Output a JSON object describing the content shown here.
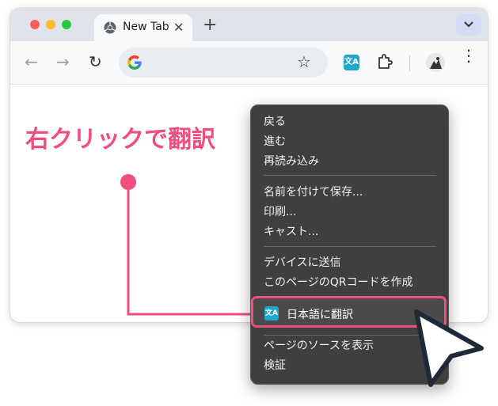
{
  "browser": {
    "tab": {
      "title": "New Tab",
      "close_glyph": "✕",
      "favicon": "chrome-icon"
    },
    "new_tab_glyph": "+",
    "tab_search_glyph": "⌄",
    "nav": {
      "back": "←",
      "forward": "→",
      "reload": "↻"
    },
    "omnibox": {
      "value": "",
      "star_glyph": "☆"
    },
    "extensions": {
      "translate_label": "文A"
    },
    "menu_glyph": "⋮"
  },
  "caption": "右クリックで翻訳",
  "context_menu": {
    "group1": [
      "戻る",
      "進む",
      "再読み込み"
    ],
    "group2": [
      "名前を付けて保存...",
      "印刷...",
      "キャスト..."
    ],
    "group3": [
      "デバイスに送信",
      "このページのQRコードを作成"
    ],
    "highlighted": {
      "icon_label": "文A",
      "label": "日本語に翻訳"
    },
    "group5": [
      "ページのソースを表示",
      "検証"
    ]
  },
  "colors": {
    "accent": "#f04e7c",
    "translate_icon": "#1fa8c9",
    "menu_bg": "#3f3f3f"
  }
}
